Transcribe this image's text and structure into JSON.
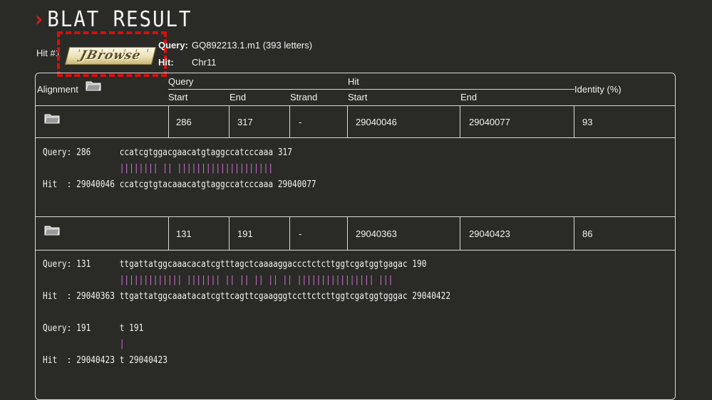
{
  "page": {
    "title": "BLAT RESULT",
    "title_chevron": "›"
  },
  "hit": {
    "label": "Hit #1",
    "jbrowse_label": "JBrowse",
    "query_label": "Query:",
    "query_value": "GQ892213.1.m1 (393 letters)",
    "hit_label": "Hit:",
    "hit_value": "Chr11"
  },
  "table": {
    "headers": {
      "alignment": "Alignment",
      "query_group": "Query",
      "hit_group": "Hit",
      "query_start": "Start",
      "query_end": "End",
      "strand": "Strand",
      "hit_start": "Start",
      "hit_end": "End",
      "identity": "Identity (%)"
    },
    "rows": [
      {
        "query_start": "286",
        "query_end": "317",
        "strand": "-",
        "hit_start": "29040046",
        "hit_end": "29040077",
        "identity": "93",
        "alignment_lines": [
          {
            "type": "query",
            "text": "Query: 286      ccatcgtggacgaacatgtaggccatcccaaa 317"
          },
          {
            "type": "bars",
            "text": "                |||||||| || ||||||||||||||||||||"
          },
          {
            "type": "hit",
            "text": "Hit  : 29040046 ccatcgtgtacaaacatgtaggccatcccaaa 29040077"
          }
        ]
      },
      {
        "query_start": "131",
        "query_end": "191",
        "strand": "-",
        "hit_start": "29040363",
        "hit_end": "29040423",
        "identity": "86",
        "alignment_lines": [
          {
            "type": "query",
            "text": "Query: 131      ttgattatggcaaacacatcgtttagctcaaaaggaccctctcttggtcgatggtgagac 190"
          },
          {
            "type": "bars",
            "text": "                ||||||||||||| ||||||| || || || || || |||||||||||||||| |||"
          },
          {
            "type": "hit",
            "text": "Hit  : 29040363 ttgattatggcaaatacatcgttcagttcgaagggtccttctcttggtcgatggtgggac 29040422"
          },
          {
            "type": "blank",
            "text": ""
          },
          {
            "type": "query",
            "text": "Query: 191      t 191"
          },
          {
            "type": "bars",
            "text": "                |"
          },
          {
            "type": "hit",
            "text": "Hit  : 29040423 t 29040423"
          }
        ]
      }
    ]
  },
  "colors": {
    "background": "#2a2a27",
    "accent_red": "#e11d1d",
    "match_bars": "#d776d9",
    "border": "#d9d9d9"
  }
}
